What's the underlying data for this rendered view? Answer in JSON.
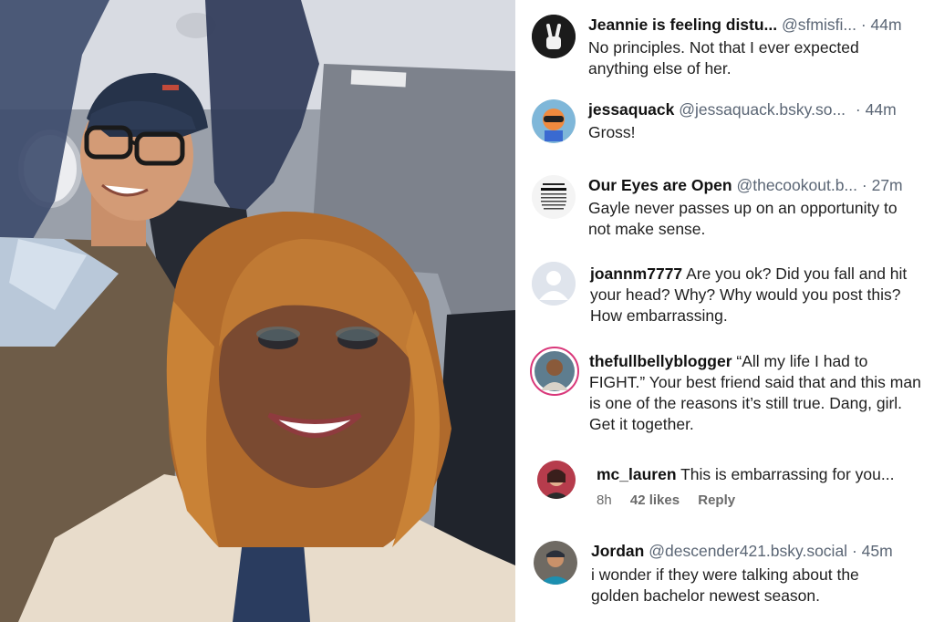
{
  "comments": [
    {
      "name": "Jeannie is feeling distu...",
      "handle": "@sfmisfi...",
      "time": "· 44m",
      "text": "No principles. Not that I ever expected anything else of her.",
      "avatar_icon": "peace-sign-icon"
    },
    {
      "name": "jessaquack",
      "handle": "@jessaquack.bsky.so...",
      "time": "· 44m",
      "text": "Gross!",
      "avatar_icon": "splatoon-character-icon"
    },
    {
      "name": "Our Eyes are Open",
      "handle": "@thecookout.b...",
      "time": "· 27m",
      "text": "Gayle never passes up on an opportunity to not make sense.",
      "avatar_icon": "first-amendment-text-icon"
    },
    {
      "name": "joannm7777",
      "text": "Are you ok? Did you fall and hit your head? Why? Why would you post this? How embarrassing.",
      "avatar_icon": "default-user-icon"
    },
    {
      "name": "thefullbellyblogger",
      "text": "“All my life I had to FIGHT.” Your best friend said that and this man is one of the reasons it’s still true. Dang, girl. Get it together.",
      "avatar_icon": "user-photo-icon"
    },
    {
      "name": "mc_lauren",
      "text": "This is embarrassing for you...",
      "ago": "8h",
      "likes": "42 likes",
      "reply": "Reply",
      "avatar_icon": "user-photo-icon"
    },
    {
      "name": "Jordan",
      "handle": "@descender421.bsky.social",
      "time": "· 45m",
      "text": "i wonder if they were talking about the golden bachelor newest season.",
      "avatar_icon": "user-photo-icon"
    }
  ],
  "colors": {
    "handle": "#5b6675",
    "text": "#1f1f1f",
    "panel_bg": "#ffffff"
  }
}
